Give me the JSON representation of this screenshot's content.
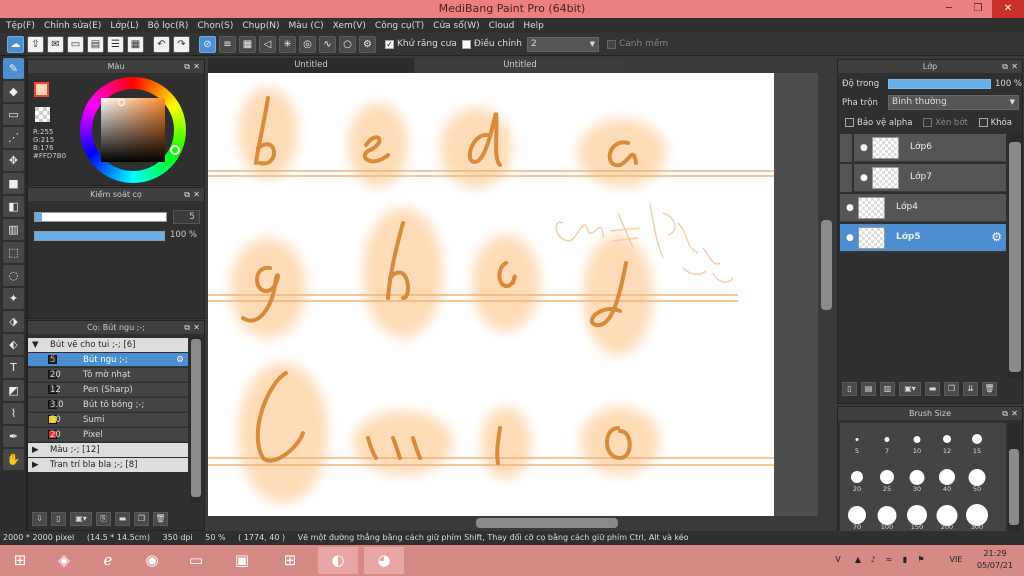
{
  "app": {
    "title": "MediBang Paint Pro (64bit)"
  },
  "window_controls": {
    "minimize": "─",
    "restore": "❐",
    "close": "✕"
  },
  "menu": [
    "Tệp(F)",
    "Chỉnh sửa(E)",
    "Lớp(L)",
    "Bộ lọc(R)",
    "Chọn(S)",
    "Chụp(N)",
    "Màu (C)",
    "Xem(V)",
    "Công cụ(T)",
    "Cửa sổ(W)",
    "Cloud",
    "Help"
  ],
  "toolbar": {
    "antialias_label": "Khử răng cưa",
    "correction_label": "Điều chỉnh",
    "correction_value": "2",
    "smooth_label": "Canh mềm"
  },
  "tabs": [
    {
      "label": "Untitled"
    },
    {
      "label": "Untitled"
    }
  ],
  "color_panel": {
    "title": "Màu",
    "rgb_lines": [
      "R:255",
      "G:215",
      "B:176",
      "#FFD7B0"
    ],
    "fg_color": "#FFD7B0"
  },
  "brush_control": {
    "title": "Kiểm soát cọ",
    "size_value": "5",
    "opacity_value": "100 %",
    "size_fraction": 0.05,
    "opacity_fraction": 1.0
  },
  "brush_panel": {
    "title": "Cọ: Bút ngu ;-;",
    "group1": "Bút vẽ cho tui ;-; [6]",
    "items": [
      {
        "size": "5",
        "name": "Bút ngu ;-;",
        "swatch": "#2a2a2a",
        "active": true
      },
      {
        "size": "20",
        "name": "Tô mờ nhạt",
        "swatch": "#2a2a2a",
        "active": false
      },
      {
        "size": "12",
        "name": "Pen (Sharp)",
        "swatch": "#2a2a2a",
        "active": false
      },
      {
        "size": "3.0",
        "name": "Bút tô bóng ;-;",
        "swatch": "#2a2a2a",
        "active": false
      },
      {
        "size": "50",
        "name": "Sumi",
        "swatch": "#f0d000",
        "active": false
      },
      {
        "size": "20",
        "name": "Pixel",
        "swatch": "#e03030",
        "active": false
      }
    ],
    "group2": "Màu ;-; [12]",
    "group3": "Tran trí bla bla ;-; [8]"
  },
  "layer_panel": {
    "title": "Lớp",
    "opacity_label": "Độ trong",
    "opacity_value": "100 %",
    "blend_label": "Pha trộn",
    "blend_value": "Bình thường",
    "protect_alpha": "Bảo vệ alpha",
    "clipping": "Xén bớt",
    "lock": "Khóa",
    "layers": [
      {
        "name": "Lớp6",
        "selected": false
      },
      {
        "name": "Lớp7",
        "selected": false
      },
      {
        "name": "Lớp4",
        "selected": false
      },
      {
        "name": "Lớp5",
        "selected": true
      }
    ]
  },
  "brush_size_panel": {
    "title": "Brush Size",
    "sizes": [
      "5",
      "7",
      "10",
      "12",
      "15",
      "20",
      "25",
      "30",
      "40",
      "50",
      "70",
      "100",
      "150",
      "200",
      "300"
    ]
  },
  "status": {
    "dimensions": "2000 * 2000 pixel",
    "physical": "(14.5 * 14.5cm)",
    "dpi": "350 dpi",
    "zoom": "50 %",
    "coords": "( 1774, 40 )",
    "hint": "Vẽ một đường thẳng bằng cách giữ phím Shift, Thay đổi cỡ cọ bằng cách giữ phím Ctrl, Alt và kéo"
  },
  "taskbar": {
    "lang": "VIE",
    "time": "21:29",
    "date": "05/07/21"
  }
}
